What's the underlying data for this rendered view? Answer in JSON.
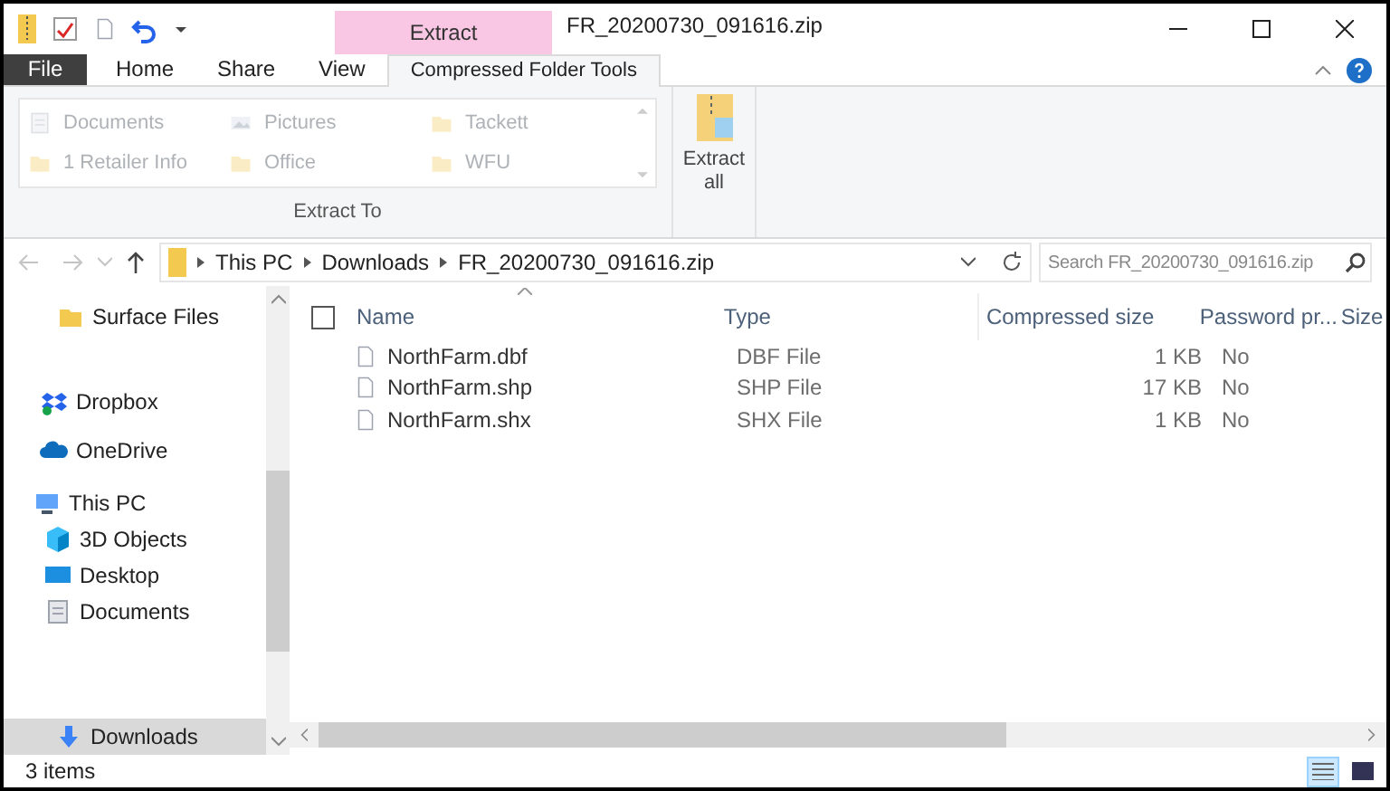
{
  "title_bar": {
    "context_label": "Extract",
    "title": "FR_20200730_091616.zip"
  },
  "ribbon_tabs": [
    {
      "label": "File",
      "kind": "file",
      "selected": false
    },
    {
      "label": "Home",
      "kind": "tab",
      "selected": false
    },
    {
      "label": "Share",
      "kind": "tab",
      "selected": false
    },
    {
      "label": "View",
      "kind": "tab",
      "selected": false
    },
    {
      "label": "Compressed Folder Tools",
      "kind": "tab",
      "selected": true
    }
  ],
  "ribbon": {
    "extract_to": {
      "items": [
        {
          "label": "Documents",
          "kind": "docs"
        },
        {
          "label": "Pictures",
          "kind": "pictures"
        },
        {
          "label": "Tackett",
          "kind": "folder"
        },
        {
          "label": "1 Retailer Info",
          "kind": "folder"
        },
        {
          "label": "Office",
          "kind": "folder"
        },
        {
          "label": "WFU",
          "kind": "folder"
        }
      ],
      "group_label": "Extract To"
    },
    "extract_all": "Extract all"
  },
  "address_bar": {
    "path": [
      "This PC",
      "Downloads",
      "FR_20200730_091616.zip"
    ],
    "search_placeholder": "Search FR_20200730_091616.zip"
  },
  "sidebar": {
    "items": [
      {
        "label": "Surface Files",
        "kind": "folder",
        "selected": false
      },
      {
        "label": "Dropbox",
        "kind": "dropbox",
        "selected": false
      },
      {
        "label": "OneDrive",
        "kind": "cloud",
        "selected": false
      },
      {
        "label": "This PC",
        "kind": "pc",
        "selected": false
      },
      {
        "label": "3D Objects",
        "kind": "cube",
        "selected": false
      },
      {
        "label": "Desktop",
        "kind": "desktop",
        "selected": false
      },
      {
        "label": "Documents",
        "kind": "docs",
        "selected": false
      },
      {
        "label": "Downloads",
        "kind": "download",
        "selected": true
      }
    ]
  },
  "table": {
    "select_all": {
      "checked": false
    },
    "columns": [
      "Name",
      "Type",
      "Compressed size",
      "Password pr...",
      "Size"
    ],
    "rows": [
      {
        "name": "NorthFarm.dbf",
        "type": "DBF File",
        "compressed_size": "1 KB",
        "password": "No"
      },
      {
        "name": "NorthFarm.shp",
        "type": "SHP File",
        "compressed_size": "17 KB",
        "password": "No"
      },
      {
        "name": "NorthFarm.shx",
        "type": "SHX File",
        "compressed_size": "1 KB",
        "password": "No"
      }
    ]
  },
  "status_bar": {
    "item_count": "3 items",
    "views": [
      {
        "kind": "details",
        "selected": true
      },
      {
        "kind": "large-icons",
        "selected": false
      }
    ]
  }
}
